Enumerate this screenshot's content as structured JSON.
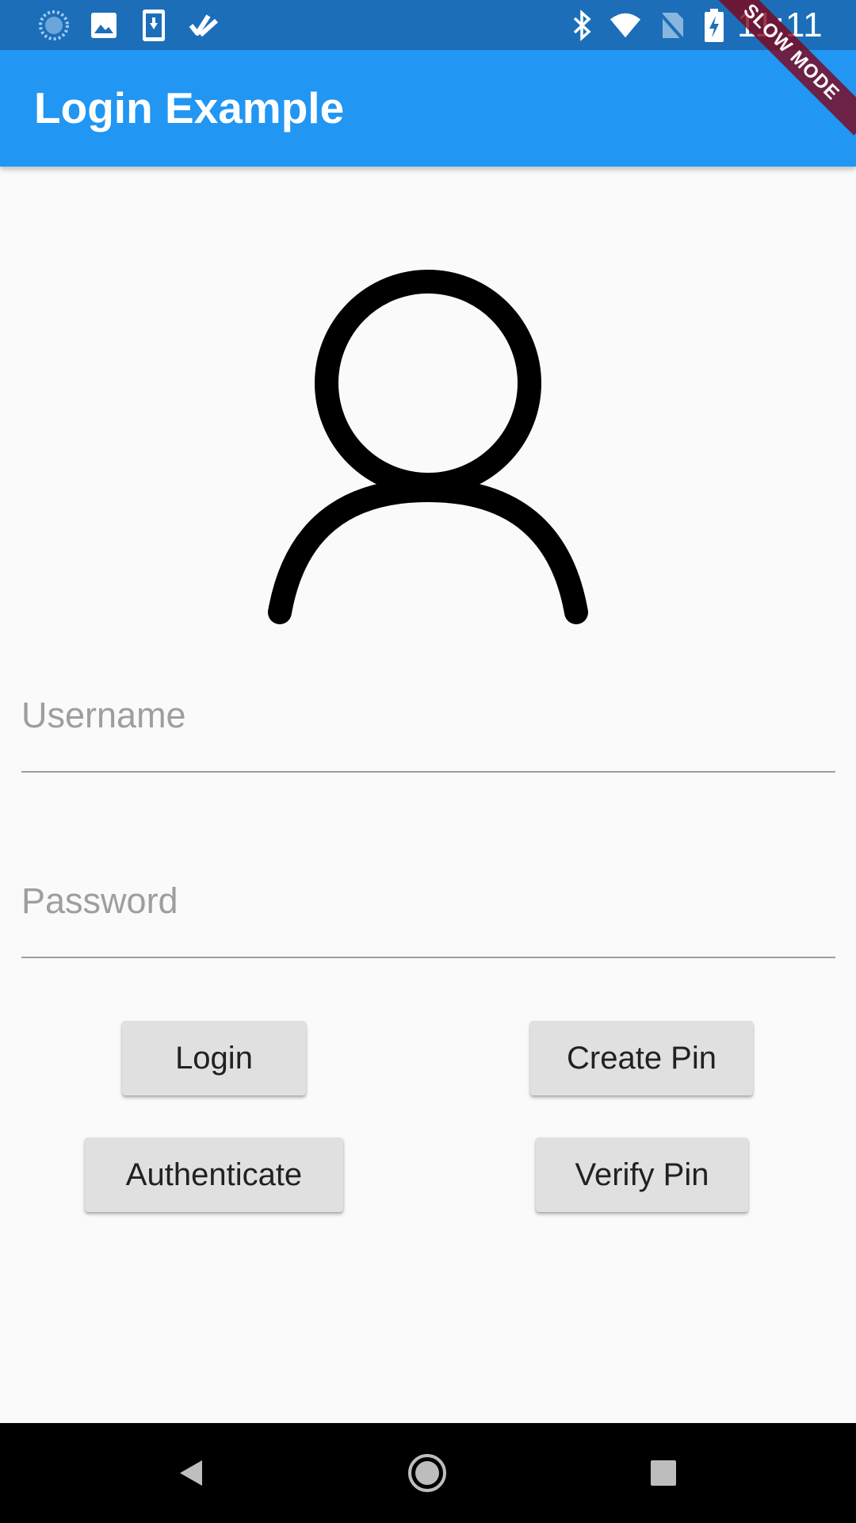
{
  "status_bar": {
    "time": "11:11",
    "left_icons": [
      "sync-icon",
      "image-icon",
      "download-icon",
      "tasks-icon"
    ],
    "right_icons": [
      "bluetooth-icon",
      "wifi-icon",
      "no-sim-icon",
      "battery-charging-icon"
    ]
  },
  "debug_banner": "SLOW MODE",
  "app_bar": {
    "title": "Login Example",
    "color": "#2196f3"
  },
  "avatar": {
    "icon": "person-outline-icon"
  },
  "form": {
    "username_placeholder": "Username",
    "password_placeholder": "Password"
  },
  "buttons": {
    "login": "Login",
    "create_pin": "Create Pin",
    "authenticate": "Authenticate",
    "verify_pin": "Verify Pin"
  },
  "nav_bar": {
    "back": "back-icon",
    "home": "home-icon",
    "recents": "recents-icon"
  }
}
